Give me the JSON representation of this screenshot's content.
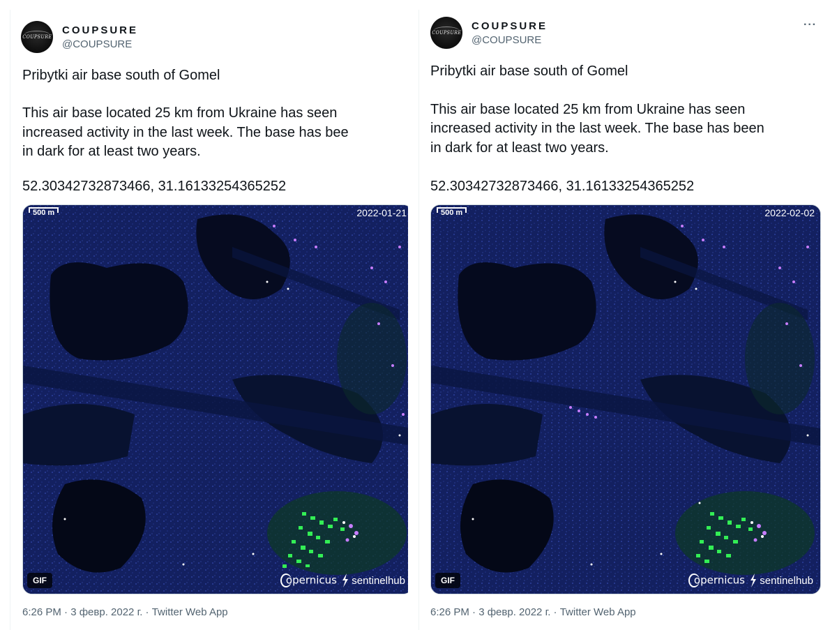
{
  "tweets": [
    {
      "author": {
        "display_name": "COUPSURE",
        "handle": "@COUPSURE",
        "avatar_text": "COUPSURE"
      },
      "text": {
        "line1": "Pribytki air base south of Gomel",
        "line2": "This air base located 25 km from Ukraine has seen",
        "line3": "increased activity in the last week. The base has bee",
        "line4": "in dark for at least two years.",
        "coords": "52.30342732873466, 31.16133254365252"
      },
      "media": {
        "scale_label": "500 m",
        "date": "2022-01-21",
        "badge": "GIF",
        "brand1": "opernicus",
        "brand2": "sentinelhub"
      },
      "meta": "6:26 PM · 3 февр. 2022 г. · Twitter Web App"
    },
    {
      "author": {
        "display_name": "COUPSURE",
        "handle": "@COUPSURE",
        "avatar_text": "COUPSURE"
      },
      "more_label": "···",
      "text": {
        "line1": "Pribytki air base south of Gomel",
        "line2": "This air base located 25 km from Ukraine has seen",
        "line3": "increased activity in the last week. The base has been",
        "line4": "in dark for at least two years.",
        "coords": "52.30342732873466, 31.16133254365252"
      },
      "media": {
        "scale_label": "500 m",
        "date": "2022-02-02",
        "badge": "GIF",
        "brand1": "opernicus",
        "brand2": "sentinelhub"
      },
      "meta": "6:26 PM · 3 февр. 2022 г. · Twitter Web App"
    }
  ]
}
